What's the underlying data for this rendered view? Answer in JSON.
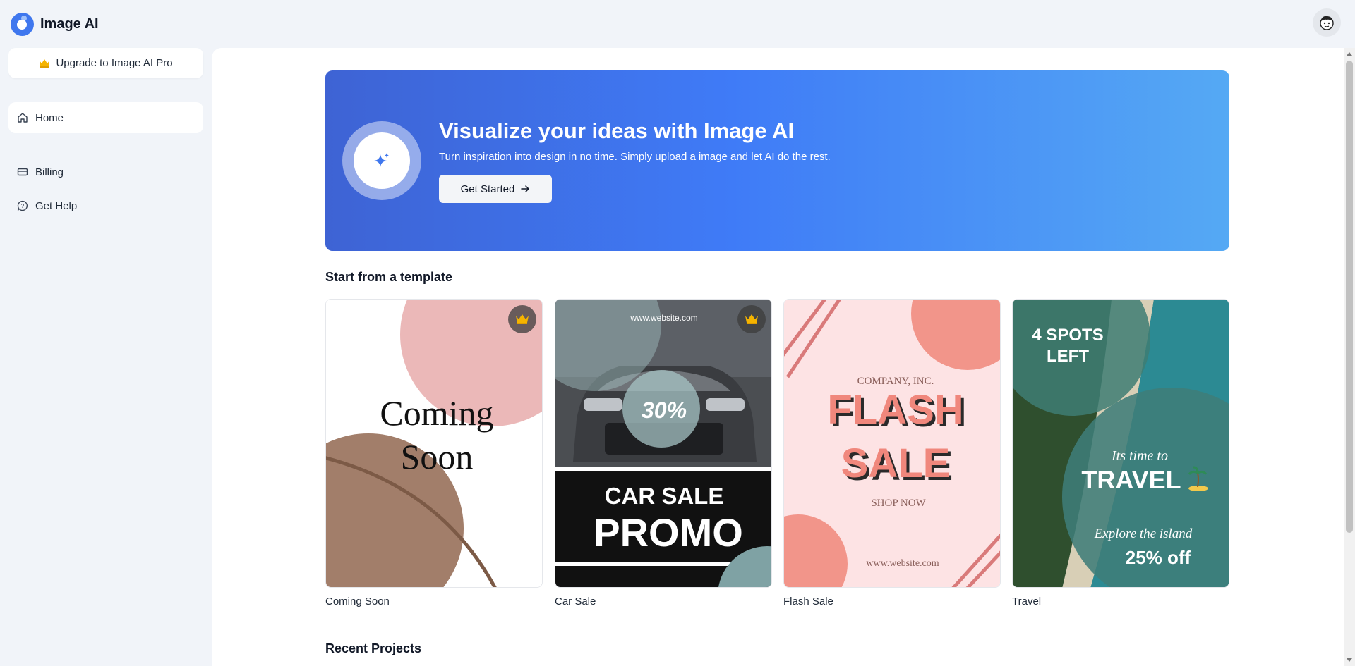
{
  "app": {
    "name": "Image AI"
  },
  "sidebar": {
    "upgrade_label": "Upgrade to Image AI Pro",
    "items": [
      {
        "label": "Home",
        "icon": "home-icon",
        "active": true
      },
      {
        "label": "Billing",
        "icon": "credit-card-icon"
      },
      {
        "label": "Get Help",
        "icon": "help-chat-icon"
      }
    ]
  },
  "hero": {
    "title": "Visualize your ideas with Image AI",
    "subtitle": "Turn inspiration into design in no time. Simply upload a image and let AI do the rest.",
    "button_label": "Get Started"
  },
  "templates": {
    "title": "Start from a template",
    "items": [
      {
        "label": "Coming Soon",
        "premium": true,
        "art": {
          "line1": "Coming",
          "line2": "Soon"
        }
      },
      {
        "label": "Car Sale",
        "premium": true,
        "art": {
          "url": "www.website.com",
          "badge": "30%",
          "line1": "CAR SALE",
          "line2": "PROMO"
        }
      },
      {
        "label": "Flash Sale",
        "premium": false,
        "art": {
          "company": "COMPANY, INC.",
          "line1": "FLASH",
          "line2": "SALE",
          "cta": "SHOP NOW",
          "url": "www.website.com"
        }
      },
      {
        "label": "Travel",
        "premium": false,
        "art": {
          "spots1": "4 SPOTS",
          "spots2": "LEFT",
          "script1": "Its time to",
          "headline": "TRAVEL",
          "script2": "Explore the island",
          "offer": "25% off"
        }
      }
    ]
  },
  "recent": {
    "title": "Recent Projects"
  },
  "colors": {
    "accent": "#3f77ee",
    "hero_start": "#3e63d4",
    "hero_end": "#55a9f4",
    "crown": "#f5b400"
  }
}
